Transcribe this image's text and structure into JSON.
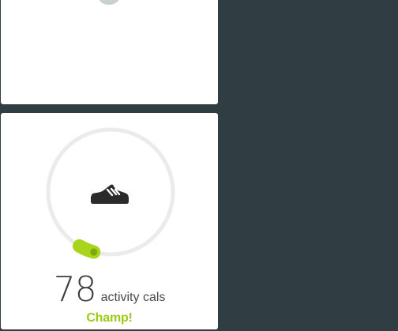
{
  "theme": {
    "background": "#303e43",
    "tile_background": "#ffffff",
    "ring_track_color": "#ebebeb",
    "ring_progress_color": "#a8d41e",
    "accent_color": "#9ccb16",
    "icon_color": "#2b2b2b"
  },
  "tiles": [
    {
      "id": "previous-tile",
      "icon": "dot-indicator-icon"
    },
    {
      "id": "activity-calories-tile",
      "icon": "shoe-icon",
      "value": "78",
      "unit": "activity cals",
      "status": "Champ!",
      "goal_progress": 0.04
    }
  ]
}
